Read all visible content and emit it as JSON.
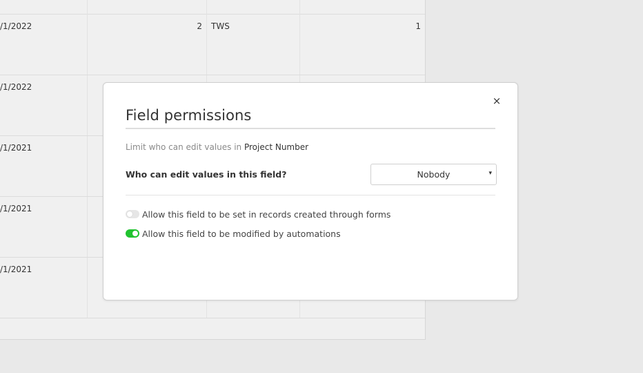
{
  "background_grid": {
    "rows": [
      {
        "date": "/1/2022",
        "count": "2",
        "code": "TWS",
        "value": "1"
      },
      {
        "date": "/1/2022",
        "count": "",
        "code": "",
        "value": ""
      },
      {
        "date": "/1/2021",
        "count": "",
        "code": "",
        "value": ""
      },
      {
        "date": "/1/2021",
        "count": "",
        "code": "",
        "value": ""
      },
      {
        "date": "/1/2021",
        "count": "",
        "code": "",
        "value": ""
      }
    ]
  },
  "modal": {
    "title": "Field permissions",
    "close_label": "×",
    "limit_prefix": "Limit who can edit values in ",
    "field_name": "Project Number",
    "question": "Who can edit values in this field?",
    "select": {
      "value": "Nobody",
      "caret": "▾"
    },
    "toggles": [
      {
        "label": "Allow this field to be set in records created through forms",
        "on": false
      },
      {
        "label": "Allow this field to be modified by automations",
        "on": true
      }
    ]
  },
  "colors": {
    "toggle_on": "#21c330",
    "toggle_off": "#e6e6e6",
    "page_background": "#e9e9e9"
  }
}
